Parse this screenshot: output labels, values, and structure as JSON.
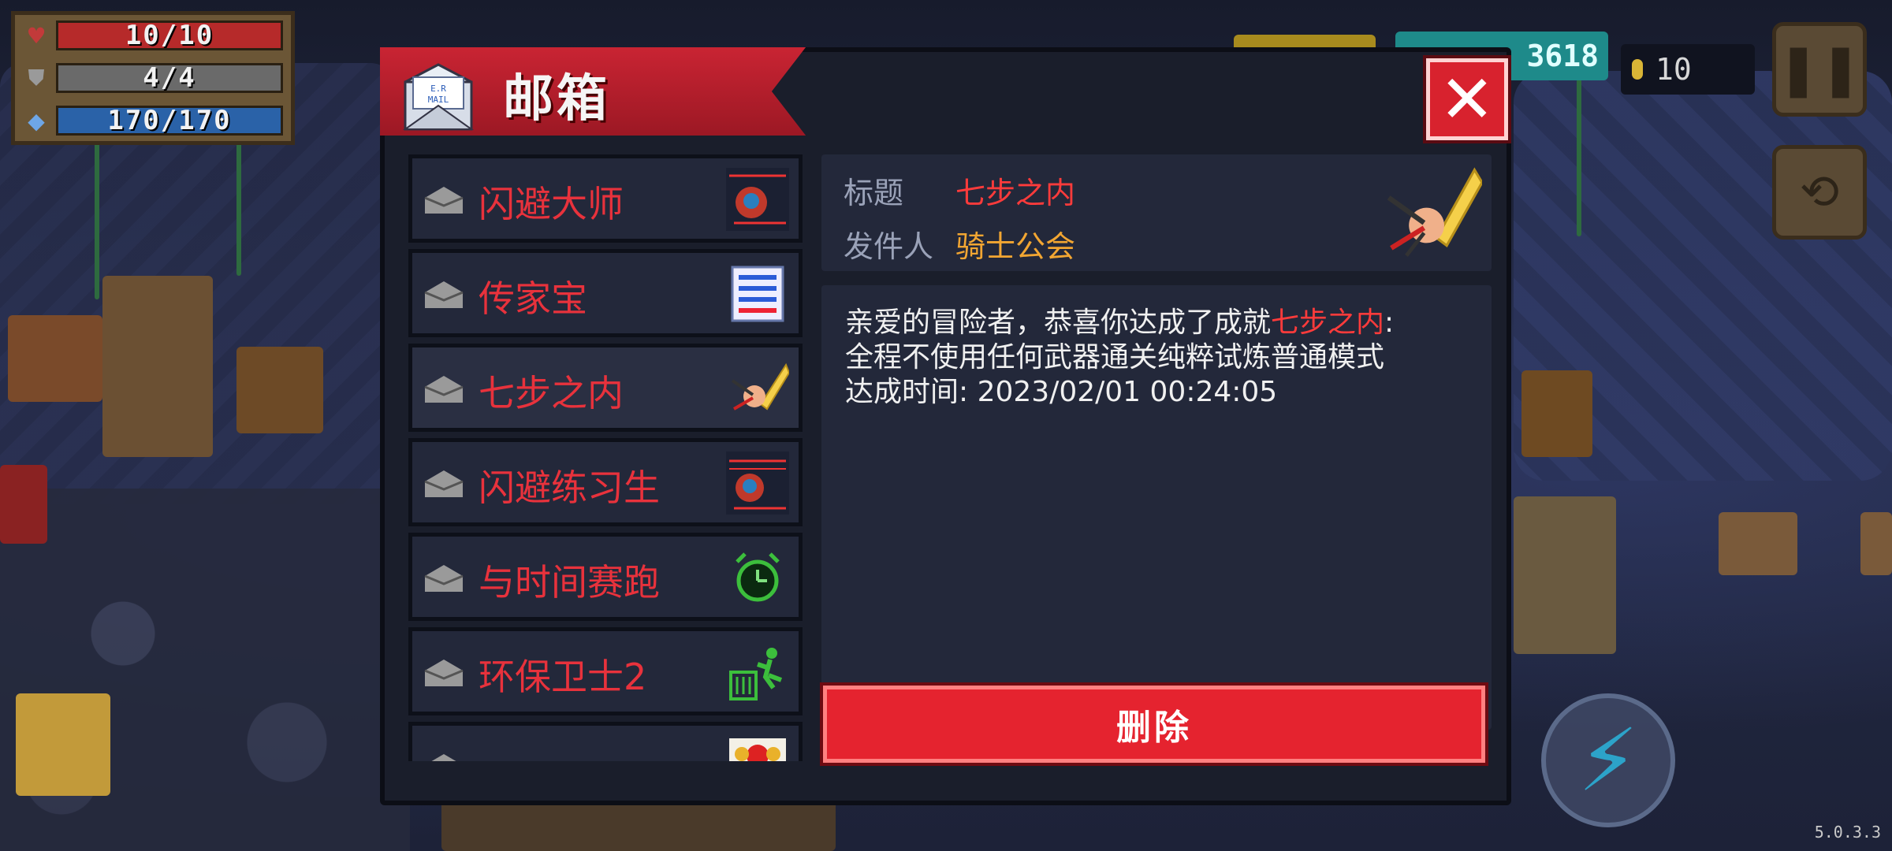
{
  "hud": {
    "health": "10/10",
    "armor": "4/4",
    "energy": "170/170",
    "health_fraction": 1.0,
    "armor_fraction": 1.0,
    "energy_fraction": 1.0,
    "gems": "3618",
    "coins": "10",
    "version": "5.0.3.3"
  },
  "dialog": {
    "title": "邮箱",
    "icon_text": "E.R MAIL",
    "close_label": "✕",
    "delete_label": "删除"
  },
  "mail_list": [
    {
      "label": "闪避大师",
      "icon": "dodge-master-icon"
    },
    {
      "label": "传家宝",
      "icon": "heirloom-icon"
    },
    {
      "label": "七步之内",
      "icon": "seven-steps-icon",
      "selected": true
    },
    {
      "label": "闪避练习生",
      "icon": "dodge-trainee-icon"
    },
    {
      "label": "与时间赛跑",
      "icon": "race-clock-icon"
    },
    {
      "label": "环保卫士2",
      "icon": "recycle-icon"
    },
    {
      "label": "",
      "icon": "partial-item-icon"
    }
  ],
  "detail": {
    "title_key": "标题",
    "title_value": "七步之内",
    "sender_key": "发件人",
    "sender_value": "骑士公会",
    "body_line1_prefix": "亲爱的冒险者，恭喜你达成了成就",
    "body_line1_highlight": "七步之内",
    "body_line1_suffix": ":",
    "body_line2": "全程不使用任何武器通关纯粹试炼普通模式",
    "body_line3": "达成时间: 2023/02/01 00:24:05"
  },
  "colors": {
    "accent_red": "#e5232f",
    "mail_label_red": "#e8323c",
    "sender_gold": "#f2a632",
    "highlight_red": "#ff3b3b"
  }
}
